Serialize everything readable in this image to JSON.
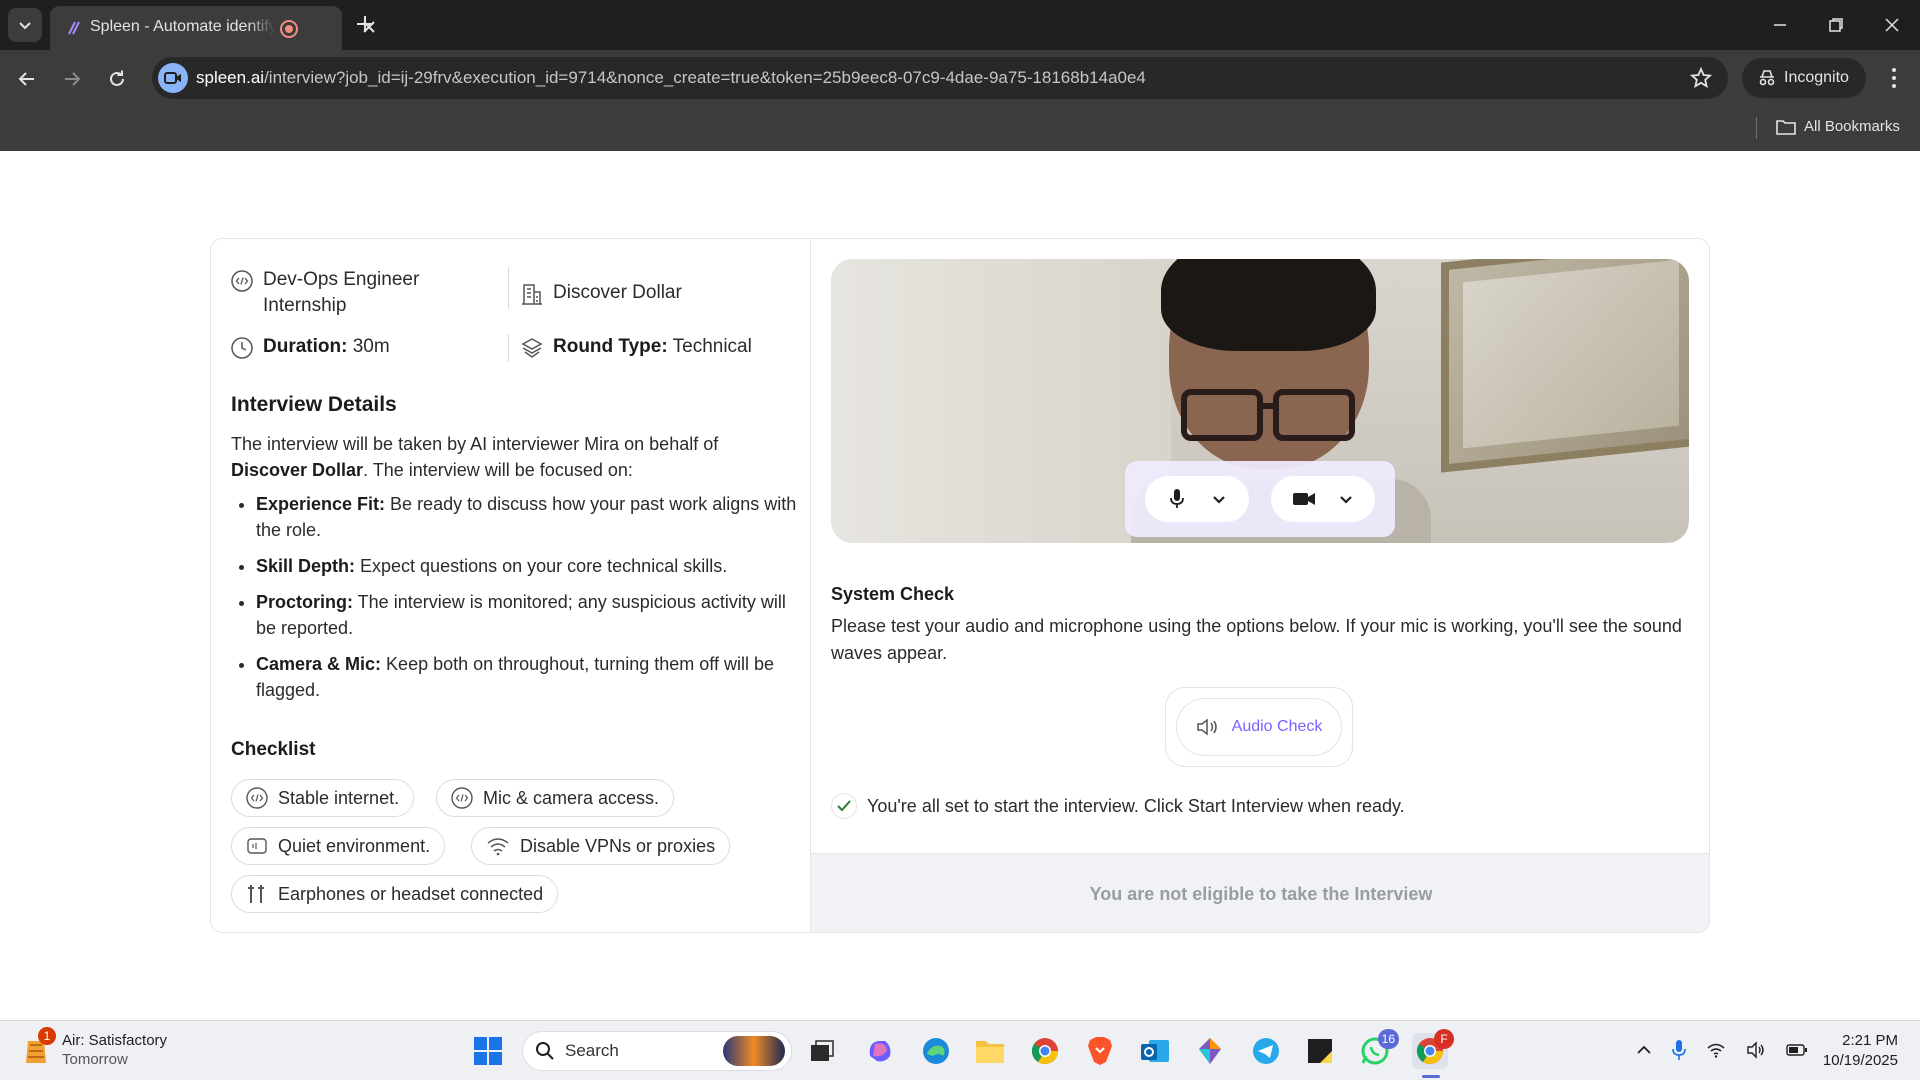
{
  "browser": {
    "tab_title": "Spleen - Automate identifying",
    "url_host": "spleen.ai",
    "url_rest": "/interview?job_id=ij-29frv&execution_id=9714&nonce_create=true&token=25b9eec8-07c9-4dae-9a75-18168b14a0e4",
    "incognito_label": "Incognito",
    "all_bookmarks_label": "All Bookmarks"
  },
  "job": {
    "role": "Dev-Ops Engineer Internship",
    "company": "Discover Dollar",
    "duration_label": "Duration:",
    "duration_value": "30m",
    "round_label": "Round Type:",
    "round_value": "Technical"
  },
  "details": {
    "title": "Interview Details",
    "intro_prefix": "The interview will be taken by AI interviewer Mira on behalf of ",
    "intro_company": "Discover Dollar",
    "intro_suffix": ". The interview will be focused on:",
    "bullets": [
      {
        "label": "Experience Fit:",
        "text": " Be ready to discuss how your past work aligns with the role."
      },
      {
        "label": "Skill Depth:",
        "text": " Expect questions on your core technical skills."
      },
      {
        "label": "Proctoring:",
        "text": " The interview is monitored; any suspicious activity will be reported."
      },
      {
        "label": "Camera & Mic:",
        "text": " Keep both on throughout, turning them off will be flagged."
      }
    ]
  },
  "checklist": {
    "title": "Checklist",
    "items": [
      {
        "label": "Stable internet.",
        "icon": "code-circle-icon"
      },
      {
        "label": "Mic & camera access.",
        "icon": "code-circle-icon"
      },
      {
        "label": "Quiet environment.",
        "icon": "mute-box-icon"
      },
      {
        "label": "Disable VPNs or proxies",
        "icon": "wifi-icon"
      },
      {
        "label": "Earphones or headset connected",
        "icon": "earphones-icon"
      }
    ]
  },
  "system_check": {
    "title": "System Check",
    "description": "Please test your audio and microphone using the options below. If your mic is working, you'll see the sound waves appear.",
    "audio_button": "Audio Check",
    "ready_message": "You're all set to start the interview. Click Start Interview when ready.",
    "eligibility": "You are not eligible to take the Interview"
  },
  "taskbar": {
    "weather_badge": "1",
    "weather_title": "Air: Satisfactory",
    "weather_sub": "Tomorrow",
    "search_placeholder": "Search",
    "whatsapp_badge": "16",
    "chrome_badge": "F",
    "time": "2:21 PM",
    "date": "10/19/2025"
  },
  "colors": {
    "accent": "#7b61ff",
    "eligibility_bg": "#f1f2f6",
    "check_green": "#2e7d32"
  }
}
